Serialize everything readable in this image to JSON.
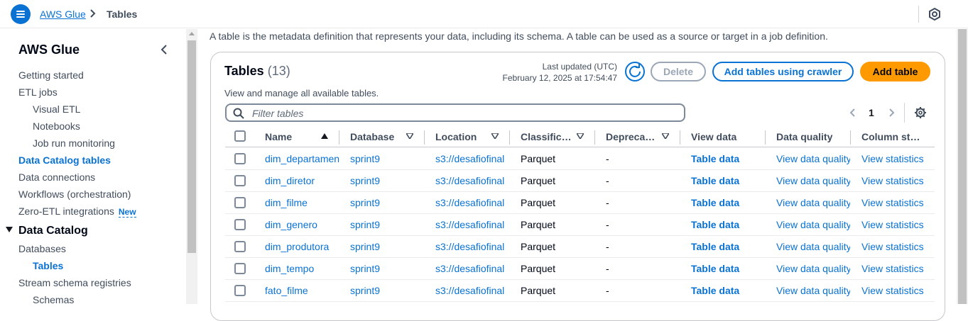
{
  "header": {
    "menu_icon": "hamburger-menu-icon",
    "breadcrumb_link": "AWS Glue",
    "breadcrumb_current": "Tables",
    "right_icon": "cloudshell-icon"
  },
  "sidebar": {
    "title": "AWS Glue",
    "items": [
      {
        "label": "Getting started"
      },
      {
        "label": "ETL jobs"
      },
      {
        "label": "Visual ETL"
      },
      {
        "label": "Notebooks"
      },
      {
        "label": "Job run monitoring"
      },
      {
        "label": "Data Catalog tables"
      },
      {
        "label": "Data connections"
      },
      {
        "label": "Workflows (orchestration)"
      },
      {
        "label": "Zero-ETL integrations",
        "badge": "New"
      }
    ],
    "section": "Data Catalog",
    "section_items": [
      {
        "label": "Databases"
      },
      {
        "label": "Tables"
      },
      {
        "label": "Stream schema registries"
      },
      {
        "label": "Schemas"
      }
    ]
  },
  "main": {
    "description": "A table is the metadata definition that represents your data, including its schema. A table can be used as a source or target in a job definition.",
    "panel": {
      "title": "Tables",
      "count": "(13)",
      "subtitle": "View and manage all available tables.",
      "last_updated_label": "Last updated (UTC)",
      "last_updated_value": "February 12, 2025 at 17:54:47",
      "delete_label": "Delete",
      "crawler_label": "Add tables using crawler",
      "add_label": "Add table",
      "filter_placeholder": "Filter tables",
      "page": "1"
    },
    "columns": [
      "Name",
      "Database",
      "Location",
      "Classific…",
      "Depreca…",
      "View data",
      "Data quality",
      "Column st…"
    ],
    "rows": [
      {
        "name": "dim_departamento",
        "database": "sprint9",
        "location": "s3://desafiofinal",
        "classification": "Parquet",
        "deprecated": "-",
        "view_data": "Table data",
        "data_quality": "View data quality",
        "column_stats": "View statistics"
      },
      {
        "name": "dim_diretor",
        "database": "sprint9",
        "location": "s3://desafiofinal",
        "classification": "Parquet",
        "deprecated": "-",
        "view_data": "Table data",
        "data_quality": "View data quality",
        "column_stats": "View statistics"
      },
      {
        "name": "dim_filme",
        "database": "sprint9",
        "location": "s3://desafiofinal",
        "classification": "Parquet",
        "deprecated": "-",
        "view_data": "Table data",
        "data_quality": "View data quality",
        "column_stats": "View statistics"
      },
      {
        "name": "dim_genero",
        "database": "sprint9",
        "location": "s3://desafiofinal",
        "classification": "Parquet",
        "deprecated": "-",
        "view_data": "Table data",
        "data_quality": "View data quality",
        "column_stats": "View statistics"
      },
      {
        "name": "dim_produtora",
        "database": "sprint9",
        "location": "s3://desafiofinal",
        "classification": "Parquet",
        "deprecated": "-",
        "view_data": "Table data",
        "data_quality": "View data quality",
        "column_stats": "View statistics"
      },
      {
        "name": "dim_tempo",
        "database": "sprint9",
        "location": "s3://desafiofinal",
        "classification": "Parquet",
        "deprecated": "-",
        "view_data": "Table data",
        "data_quality": "View data quality",
        "column_stats": "View statistics"
      },
      {
        "name": "fato_filme",
        "database": "sprint9",
        "location": "s3://desafiofinal",
        "classification": "Parquet",
        "deprecated": "-",
        "view_data": "Table data",
        "data_quality": "View data quality",
        "column_stats": "View statistics"
      }
    ],
    "colors": {
      "accent": "#0972d3",
      "primary_button": "#ff9900"
    }
  }
}
